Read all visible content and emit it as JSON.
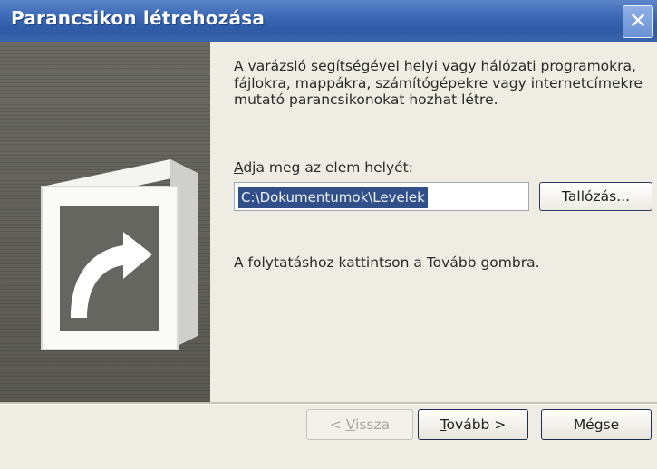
{
  "window": {
    "title": "Parancsikon létrehozása",
    "close_glyph": "✕"
  },
  "content": {
    "intro_text": "A varázsló segítségével helyi vagy hálózati programokra, fájlokra, mappákra, számítógépekre vagy internetcímekre mutató parancsikonokat hozhat létre.",
    "location_label": {
      "first": "A",
      "rest": "dja meg az elem helyét:"
    },
    "location_value": "C:\\Dokumentumok\\Levelek",
    "browse_label": {
      "pre": "Ta",
      "key": "l",
      "post": "lózás..."
    },
    "hint_text": "A folytatáshoz kattintson a Tovább gombra."
  },
  "footer": {
    "back": {
      "pre": "< ",
      "key": "V",
      "post": "issza"
    },
    "next": {
      "key": "T",
      "post": "ovább >"
    },
    "cancel": "Mégse"
  },
  "icons": {
    "wizard_art": "shortcut-arrow-icon"
  },
  "colors": {
    "titlebar": "#3f6bb8",
    "side_panel": "#5f5f58",
    "selection": "#31508a"
  }
}
